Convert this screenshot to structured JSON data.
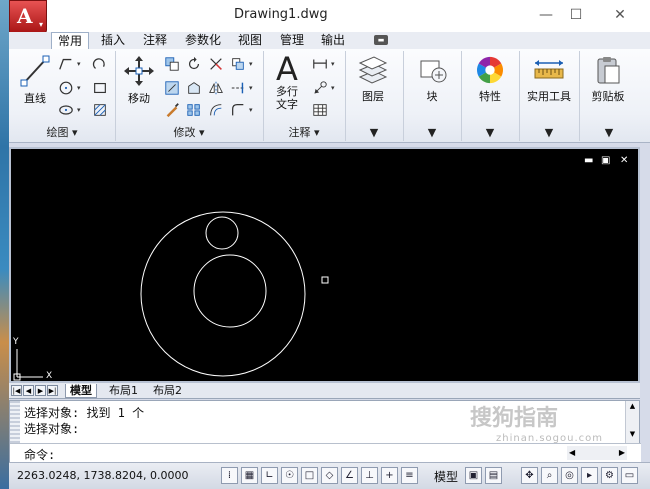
{
  "window": {
    "title": "Drawing1.dwg",
    "minimize": "—",
    "maximize": "☐",
    "close": "✕"
  },
  "app_button": {
    "glyph": "A",
    "caret": "▾"
  },
  "tabs": [
    "常用",
    "插入",
    "注释",
    "参数化",
    "视图",
    "管理",
    "输出"
  ],
  "ribbon": {
    "line_label": "直线",
    "move_label": "移动",
    "mtext_label_1": "多行",
    "mtext_label_2": "文字",
    "layers_label": "图层",
    "block_label": "块",
    "properties_label": "特性",
    "utilities_label": "实用工具",
    "clipboard_label": "剪贴板",
    "panel_draw": "绘图 ▾",
    "panel_modify": "修改 ▾",
    "panel_annotation": "注释 ▾",
    "drop": "▼"
  },
  "viewport": {
    "minimize": "▬",
    "restore": "▣",
    "close": "✕",
    "ucs_y": "Y",
    "ucs_x": "X"
  },
  "layout_tabs": {
    "nav": [
      "|◀",
      "◀",
      "▶",
      "▶|"
    ],
    "tabs": [
      "模型",
      "布局1",
      "布局2"
    ]
  },
  "command": {
    "history": [
      "选择对象: 找到 1 个",
      "选择对象:"
    ],
    "prompt": "命令:"
  },
  "status": {
    "coordinates": "2263.0248, 1738.8204, 0.0000",
    "model_label": "模型"
  },
  "watermark": {
    "text": "搜狗指南",
    "sub": "zhinan.sogou.com"
  }
}
